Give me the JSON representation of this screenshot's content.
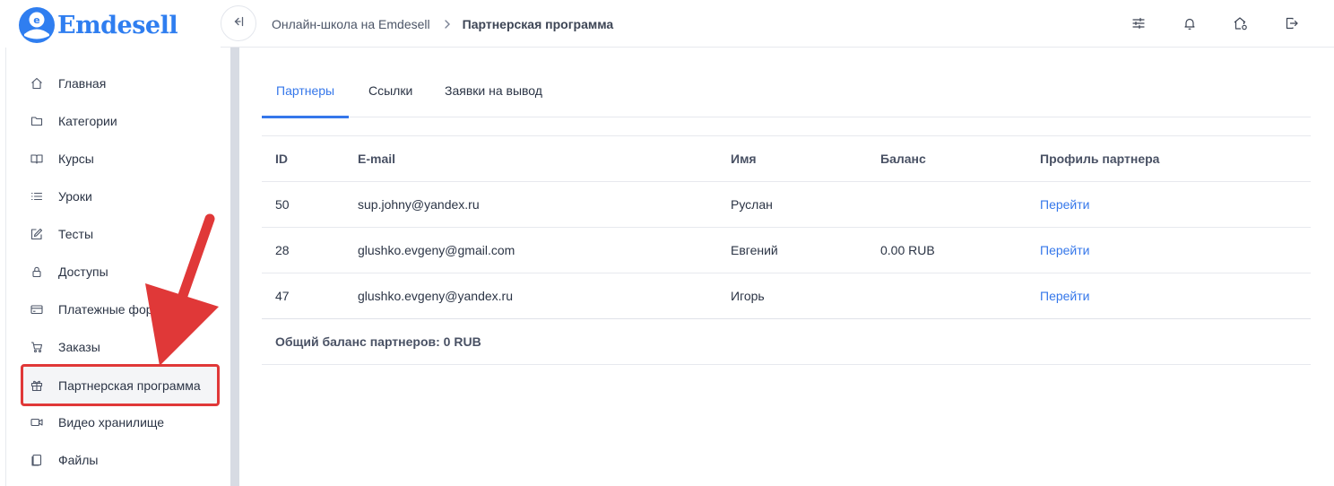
{
  "logo": {
    "text": "Emdesell",
    "mark_letter": "e"
  },
  "header": {
    "breadcrumb": [
      "Онлайн-школа на Emdesell",
      "Партнерская программа"
    ],
    "icons": [
      "collapse-sidebar-icon",
      "settings-sliders-icon",
      "bell-icon",
      "home-settings-icon",
      "logout-icon"
    ]
  },
  "sidebar": {
    "items": [
      {
        "label": "Главная",
        "icon": "home-icon"
      },
      {
        "label": "Категории",
        "icon": "folder-icon"
      },
      {
        "label": "Курсы",
        "icon": "book-icon"
      },
      {
        "label": "Уроки",
        "icon": "list-icon"
      },
      {
        "label": "Тесты",
        "icon": "edit-icon"
      },
      {
        "label": "Доступы",
        "icon": "lock-icon"
      },
      {
        "label": "Платежные формы",
        "icon": "credit-card-icon"
      },
      {
        "label": "Заказы",
        "icon": "cart-icon"
      },
      {
        "label": "Партнерская программа",
        "icon": "gift-icon",
        "active": true
      },
      {
        "label": "Видео хранилище",
        "icon": "video-icon"
      },
      {
        "label": "Файлы",
        "icon": "file-icon"
      }
    ]
  },
  "tabs": [
    {
      "label": "Партнеры",
      "active": true
    },
    {
      "label": "Ссылки",
      "active": false
    },
    {
      "label": "Заявки на вывод",
      "active": false
    }
  ],
  "table": {
    "columns": [
      "ID",
      "E-mail",
      "Имя",
      "Баланс",
      "Профиль партнера"
    ],
    "rows": [
      {
        "id": "50",
        "email": "sup.johny@yandex.ru",
        "name": "Руслан",
        "balance": "",
        "profile": "Перейти"
      },
      {
        "id": "28",
        "email": "glushko.evgeny@gmail.com",
        "name": "Евгений",
        "balance": "0.00 RUB",
        "profile": "Перейти"
      },
      {
        "id": "47",
        "email": "glushko.evgeny@yandex.ru",
        "name": "Игорь",
        "balance": "",
        "profile": "Перейти"
      }
    ],
    "total": "Общий баланс партнеров: 0 RUB"
  },
  "colors": {
    "accent": "#3577ea",
    "logo": "#2f7ef0",
    "annotation": "#e03838"
  }
}
